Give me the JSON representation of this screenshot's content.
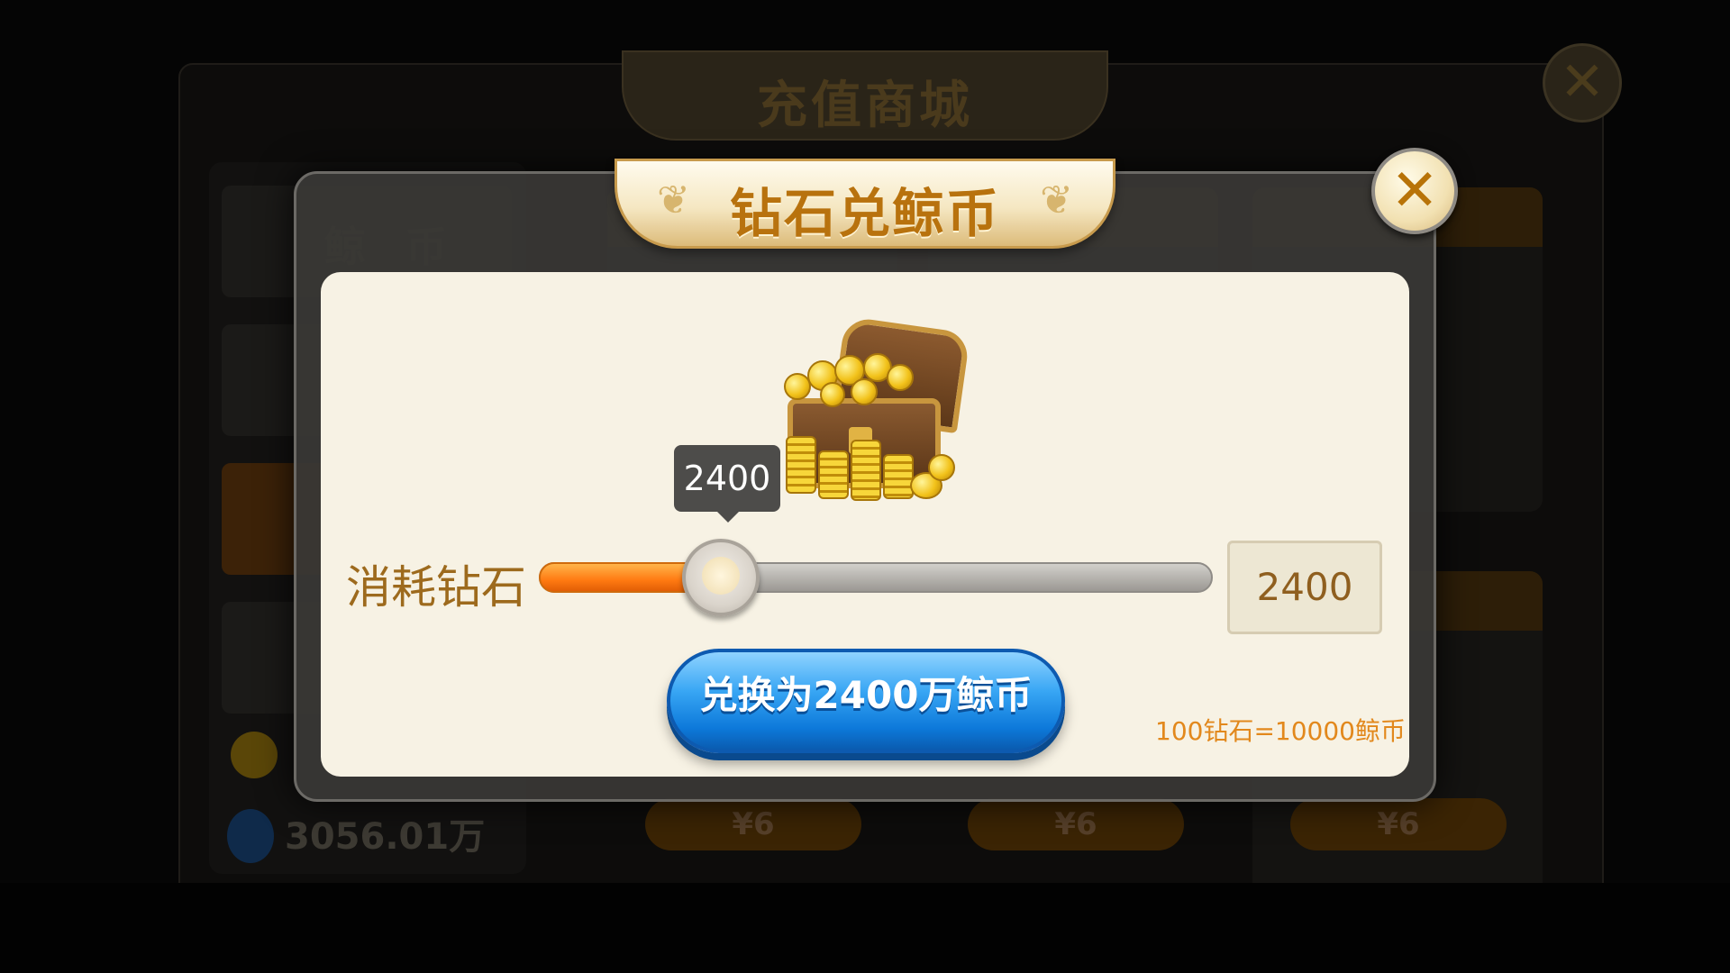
{
  "background_shop": {
    "title": "充值商城",
    "close_glyph": "✕",
    "sidebar_tab_label": "鲸 币",
    "balance": "3056.01万",
    "prices": [
      "¥6",
      "¥6",
      "¥6"
    ]
  },
  "modal": {
    "title": "钻石兑鲸币",
    "close_glyph": "✕",
    "tooltip_value": "2400",
    "slider": {
      "label": "消耗钻石",
      "value": 2400,
      "fill_fraction": 0.27
    },
    "value_box": "2400",
    "exchange_button": "兑换为2400万鲸币",
    "rate_text": "100钻石=10000鲸币"
  },
  "icons": {
    "close": "close-icon",
    "chest": "treasure-chest-icon",
    "laurel": "laurel-icon"
  },
  "colors": {
    "title_gold": "#b8720e",
    "slider_fill": "#ff7a12",
    "button_blue": "#38a6f4",
    "rate_orange": "#e2881c"
  }
}
